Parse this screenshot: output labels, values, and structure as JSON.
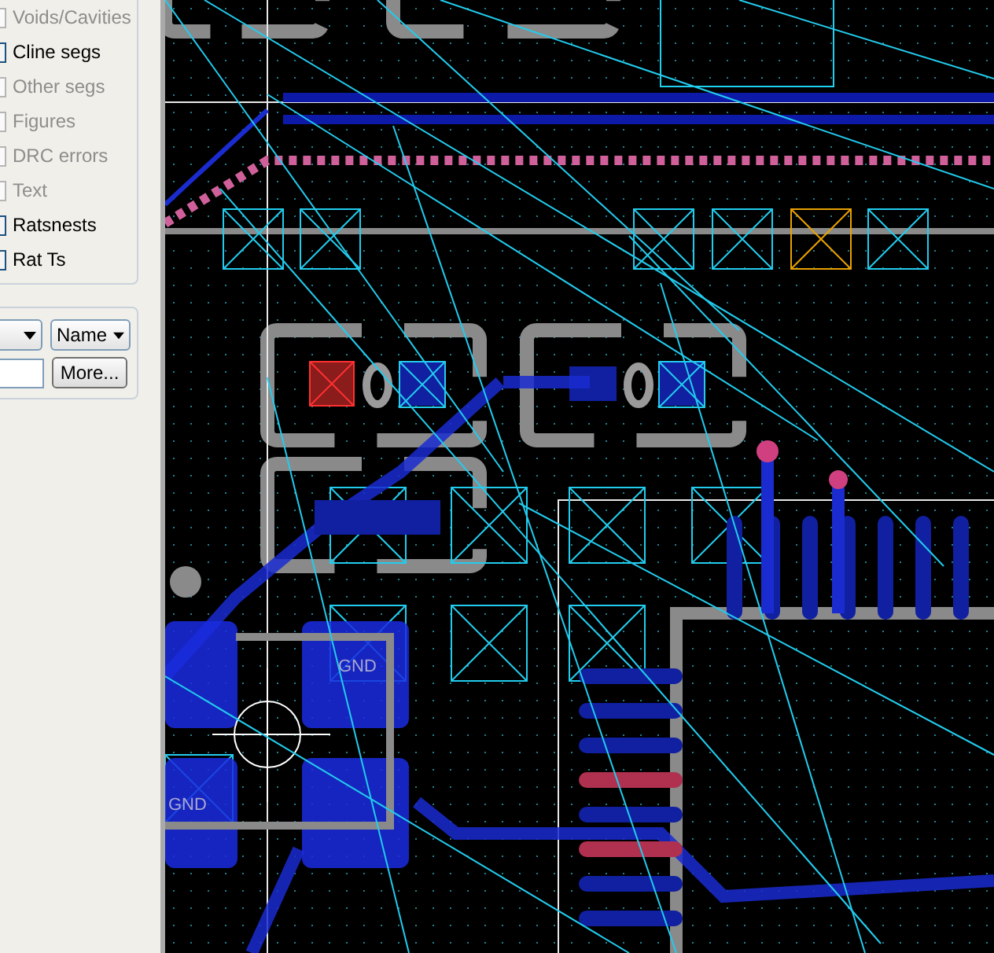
{
  "find_panel": {
    "filters": [
      {
        "label": "Voids/Cavities",
        "enabled": false
      },
      {
        "label": "Cline segs",
        "enabled": true
      },
      {
        "label": "Other segs",
        "enabled": false
      },
      {
        "label": "Figures",
        "enabled": false
      },
      {
        "label": "DRC errors",
        "enabled": false
      },
      {
        "label": "Text",
        "enabled": false
      },
      {
        "label": "Ratsnests",
        "enabled": true
      },
      {
        "label": "Rat Ts",
        "enabled": true
      }
    ],
    "name_dropdown": {
      "value": "Name"
    },
    "more_button": {
      "label": "More..."
    }
  },
  "board": {
    "pad_labels": [
      "GND",
      "GND"
    ]
  }
}
